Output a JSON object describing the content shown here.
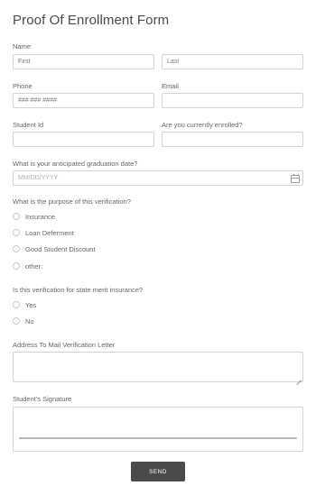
{
  "form": {
    "title": "Proof Of Enrollment Form",
    "name": {
      "label": "Name",
      "first_placeholder": "First",
      "last_placeholder": "Last"
    },
    "phone": {
      "label": "Phone",
      "placeholder": "### ### ####"
    },
    "email": {
      "label": "Email",
      "placeholder": ""
    },
    "student_id": {
      "label": "Student Id",
      "placeholder": ""
    },
    "enrolled": {
      "label": "Are you currently enrolled?",
      "placeholder": ""
    },
    "graduation": {
      "label": "What is your anticipated graduation date?",
      "placeholder": "MM/DD/YYYY",
      "icon": "calendar-icon"
    },
    "purpose": {
      "label": "What is the purpose of this verification?",
      "options": [
        "Insurance",
        "Loan Deferment",
        "Good Student Discount",
        "other:"
      ]
    },
    "state_merit": {
      "label": "Is this verification for state merit insurance?",
      "options": [
        "Yes",
        "No"
      ]
    },
    "address": {
      "label": "Address To Mail Verification Letter"
    },
    "signature": {
      "label": "Student's Signature"
    },
    "submit_label": "SEND"
  }
}
